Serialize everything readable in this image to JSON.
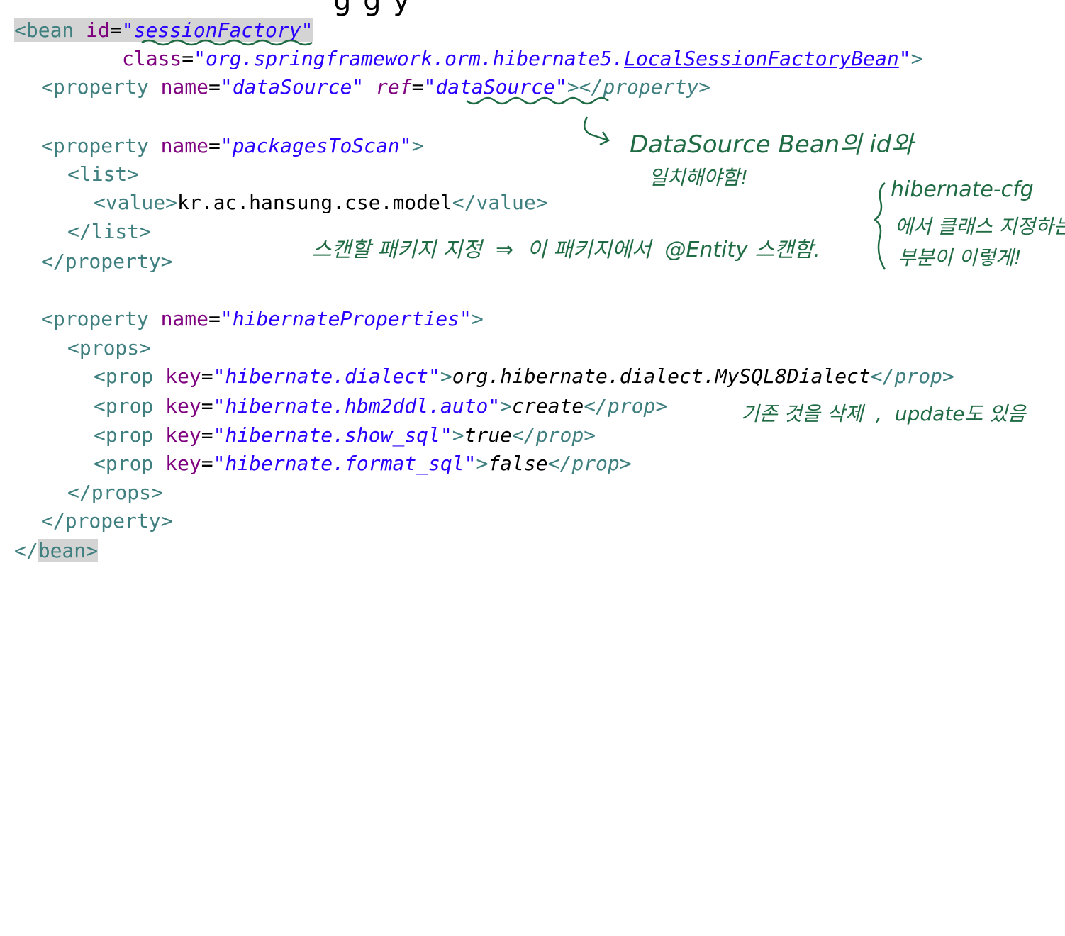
{
  "top_fragment": "g  g          y",
  "code": {
    "bean_open_lt": "<",
    "bean_tag": "bean",
    "id_attr": "id",
    "eq": "=",
    "id_value": "\"sessionFactory\"",
    "class_attr": "class",
    "class_value_prefix": "\"org.springframework.orm.hibernate5.",
    "class_value_cls": "LocalSessionFactoryBean",
    "class_value_suffix": "\"",
    "gt": ">",
    "property_open": "<property",
    "name_attr": "name",
    "ds_name_value": "\"dataSource\"",
    "ref_attr": "ref",
    "ds_ref_value": "\"dataSource\"",
    "ds_tail": "></property>",
    "pkg_name_value": "\"packagesToScan\"",
    "list_open": "<list>",
    "value_open": "<value>",
    "value_text": "kr.ac.hansung.cse.model",
    "value_close": "</value>",
    "list_close": "</list>",
    "property_close": "</property>",
    "hp_name_value": "\"hibernateProperties\"",
    "props_open": "<props>",
    "prop_open": "<prop",
    "key_attr": "key",
    "props": [
      {
        "key": "\"hibernate.dialect\"",
        "value": "org.hibernate.dialect.MySQL8Dialect"
      },
      {
        "key": "\"hibernate.hbm2ddl.auto\"",
        "value": "create"
      },
      {
        "key": "\"hibernate.show_sql\"",
        "value": "true"
      },
      {
        "key": "\"hibernate.format_sql\"",
        "value": "false"
      }
    ],
    "prop_close": "</prop>",
    "props_close": "</props>",
    "bean_close_lt": "</",
    "bean_close_gt": ">"
  },
  "annotations": {
    "datasource_note_1": "DataSource Bean의 id와",
    "datasource_note_2": "일치해야함!",
    "scan_note": "스캔할 패키지 지정  ⇒  이 패키지에서  @Entity 스캔함.",
    "cfg_note_1": "hibernate-cfg",
    "cfg_note_2": "에서 클래스 지정하는",
    "cfg_note_3": "부분이 이렇게!",
    "hbm2ddl_note": "기존 것을 삭제  ,  update도 있음"
  },
  "colors": {
    "tag": "#3f7f7f",
    "attribute": "#7f007f",
    "string": "#2a00ff",
    "text": "#000000",
    "handwriting": "#1f6b43",
    "highlight": "#d4d4d4"
  }
}
